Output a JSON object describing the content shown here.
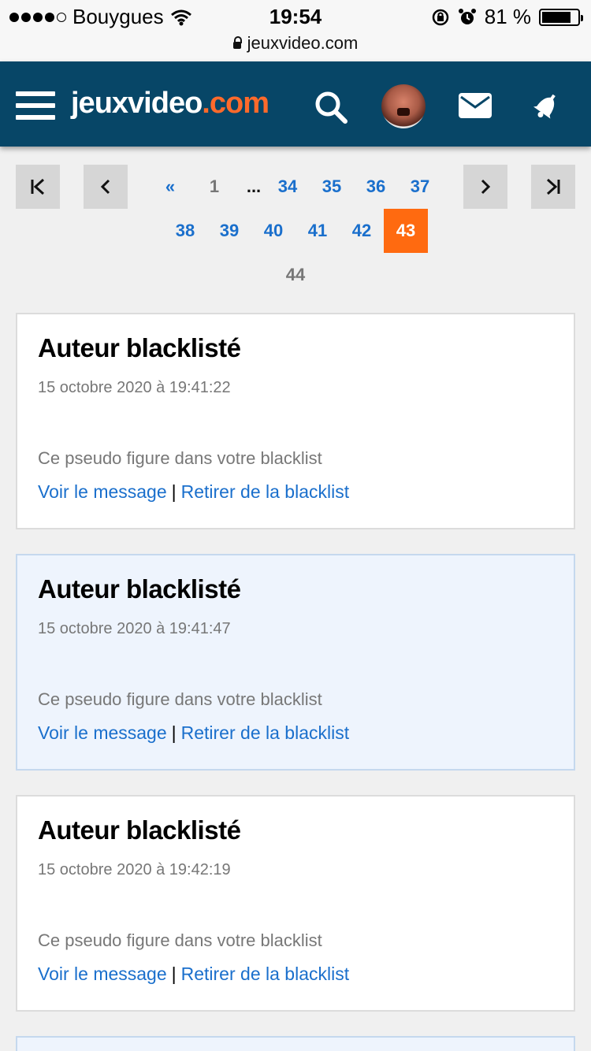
{
  "status_bar": {
    "carrier": "Bouygues",
    "time": "19:54",
    "battery": "81 %",
    "battery_level": 0.81,
    "url": "jeuxvideo.com"
  },
  "header": {
    "logo_main": "jeuxvideo",
    "logo_accent": ".com",
    "colors": {
      "bar": "#074667",
      "accent": "#ff6a2b"
    }
  },
  "pagination": {
    "row1": [
      "«",
      "1",
      "...",
      "34",
      "35",
      "36",
      "37"
    ],
    "row2": [
      "38",
      "39",
      "40",
      "41",
      "42",
      "43"
    ],
    "row3": [
      "44"
    ],
    "current": "43",
    "active_color": "#ff6a10"
  },
  "posts": [
    {
      "title": "Auteur blacklisté",
      "date": "15 octobre 2020 à 19:41:22",
      "note": "Ce pseudo figure dans votre blacklist",
      "view_link": "Voir le message",
      "separator": "|",
      "remove_link": "Retirer de la blacklist"
    },
    {
      "title": "Auteur blacklisté",
      "date": "15 octobre 2020 à 19:41:47",
      "note": "Ce pseudo figure dans votre blacklist",
      "view_link": "Voir le message",
      "separator": "|",
      "remove_link": "Retirer de la blacklist"
    },
    {
      "title": "Auteur blacklisté",
      "date": "15 octobre 2020 à 19:42:19",
      "note": "Ce pseudo figure dans votre blacklist",
      "view_link": "Voir le message",
      "separator": "|",
      "remove_link": "Retirer de la blacklist"
    }
  ]
}
